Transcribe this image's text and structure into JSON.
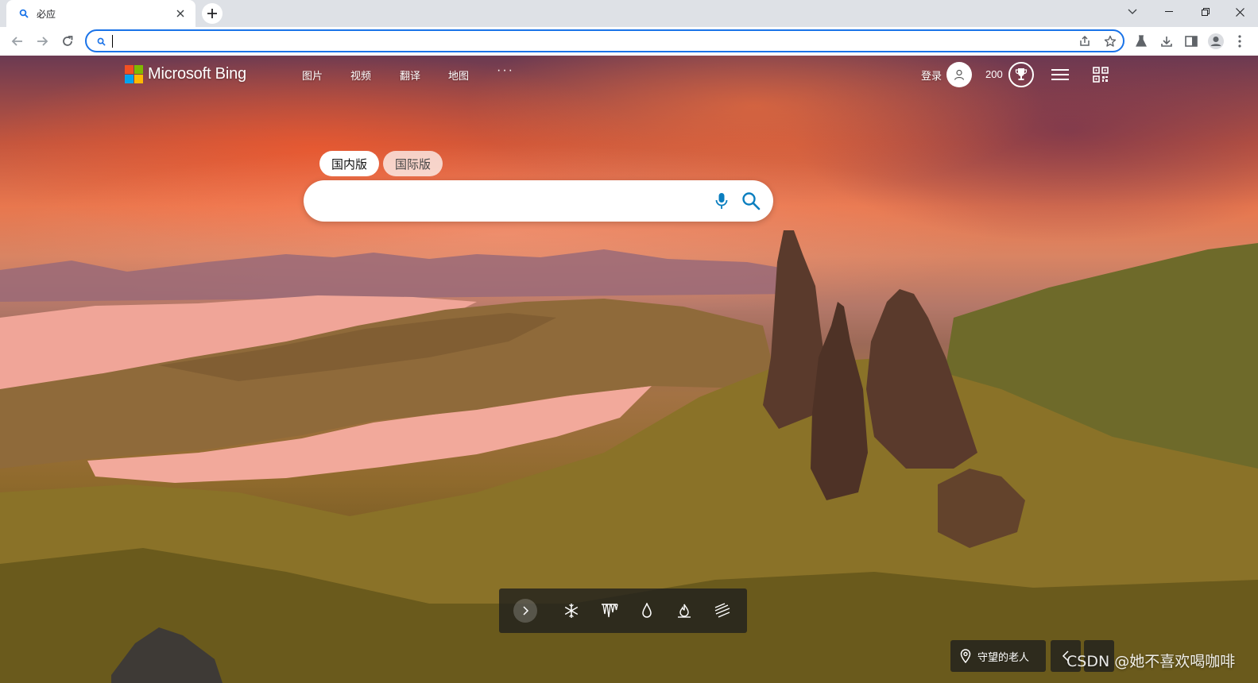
{
  "browser": {
    "tab": {
      "title": "必应",
      "favicon": "bing-search-icon",
      "close_icon": "close-icon"
    },
    "new_tab_icon": "plus-icon",
    "window_controls": [
      "chevron-down-icon",
      "minimize-icon",
      "restore-icon",
      "close-icon"
    ],
    "nav": [
      "back-arrow-icon",
      "forward-arrow-icon",
      "reload-icon"
    ],
    "address_bar": {
      "value": "",
      "leading_icon": "search-icon",
      "actions": [
        "share-icon",
        "star-icon"
      ]
    },
    "toolbar_icons": [
      "flask-icon",
      "download-icon",
      "side-panel-icon",
      "profile-icon",
      "more-vert-icon"
    ],
    "accent_color": "#1a73e8"
  },
  "bing": {
    "logo_text": "Microsoft Bing",
    "logo_colors": [
      "#f25022",
      "#7fba00",
      "#00a4ef",
      "#ffb900"
    ],
    "nav_items": [
      "图片",
      "视频",
      "翻译",
      "地图"
    ],
    "nav_more": "···",
    "signin": "登录",
    "points": "200",
    "editions": {
      "domestic": "国内版",
      "international": "国际版",
      "active": "国内版"
    },
    "search": {
      "value": "",
      "placeholder": ""
    },
    "weather_icons": [
      "chevron-right-icon",
      "snowflake-icon",
      "icicle-icon",
      "raindrop-icon",
      "flame-icon",
      "wind-icon"
    ],
    "image_location": "守望的老人",
    "watermark": "CSDN @她不喜欢喝咖啡"
  }
}
